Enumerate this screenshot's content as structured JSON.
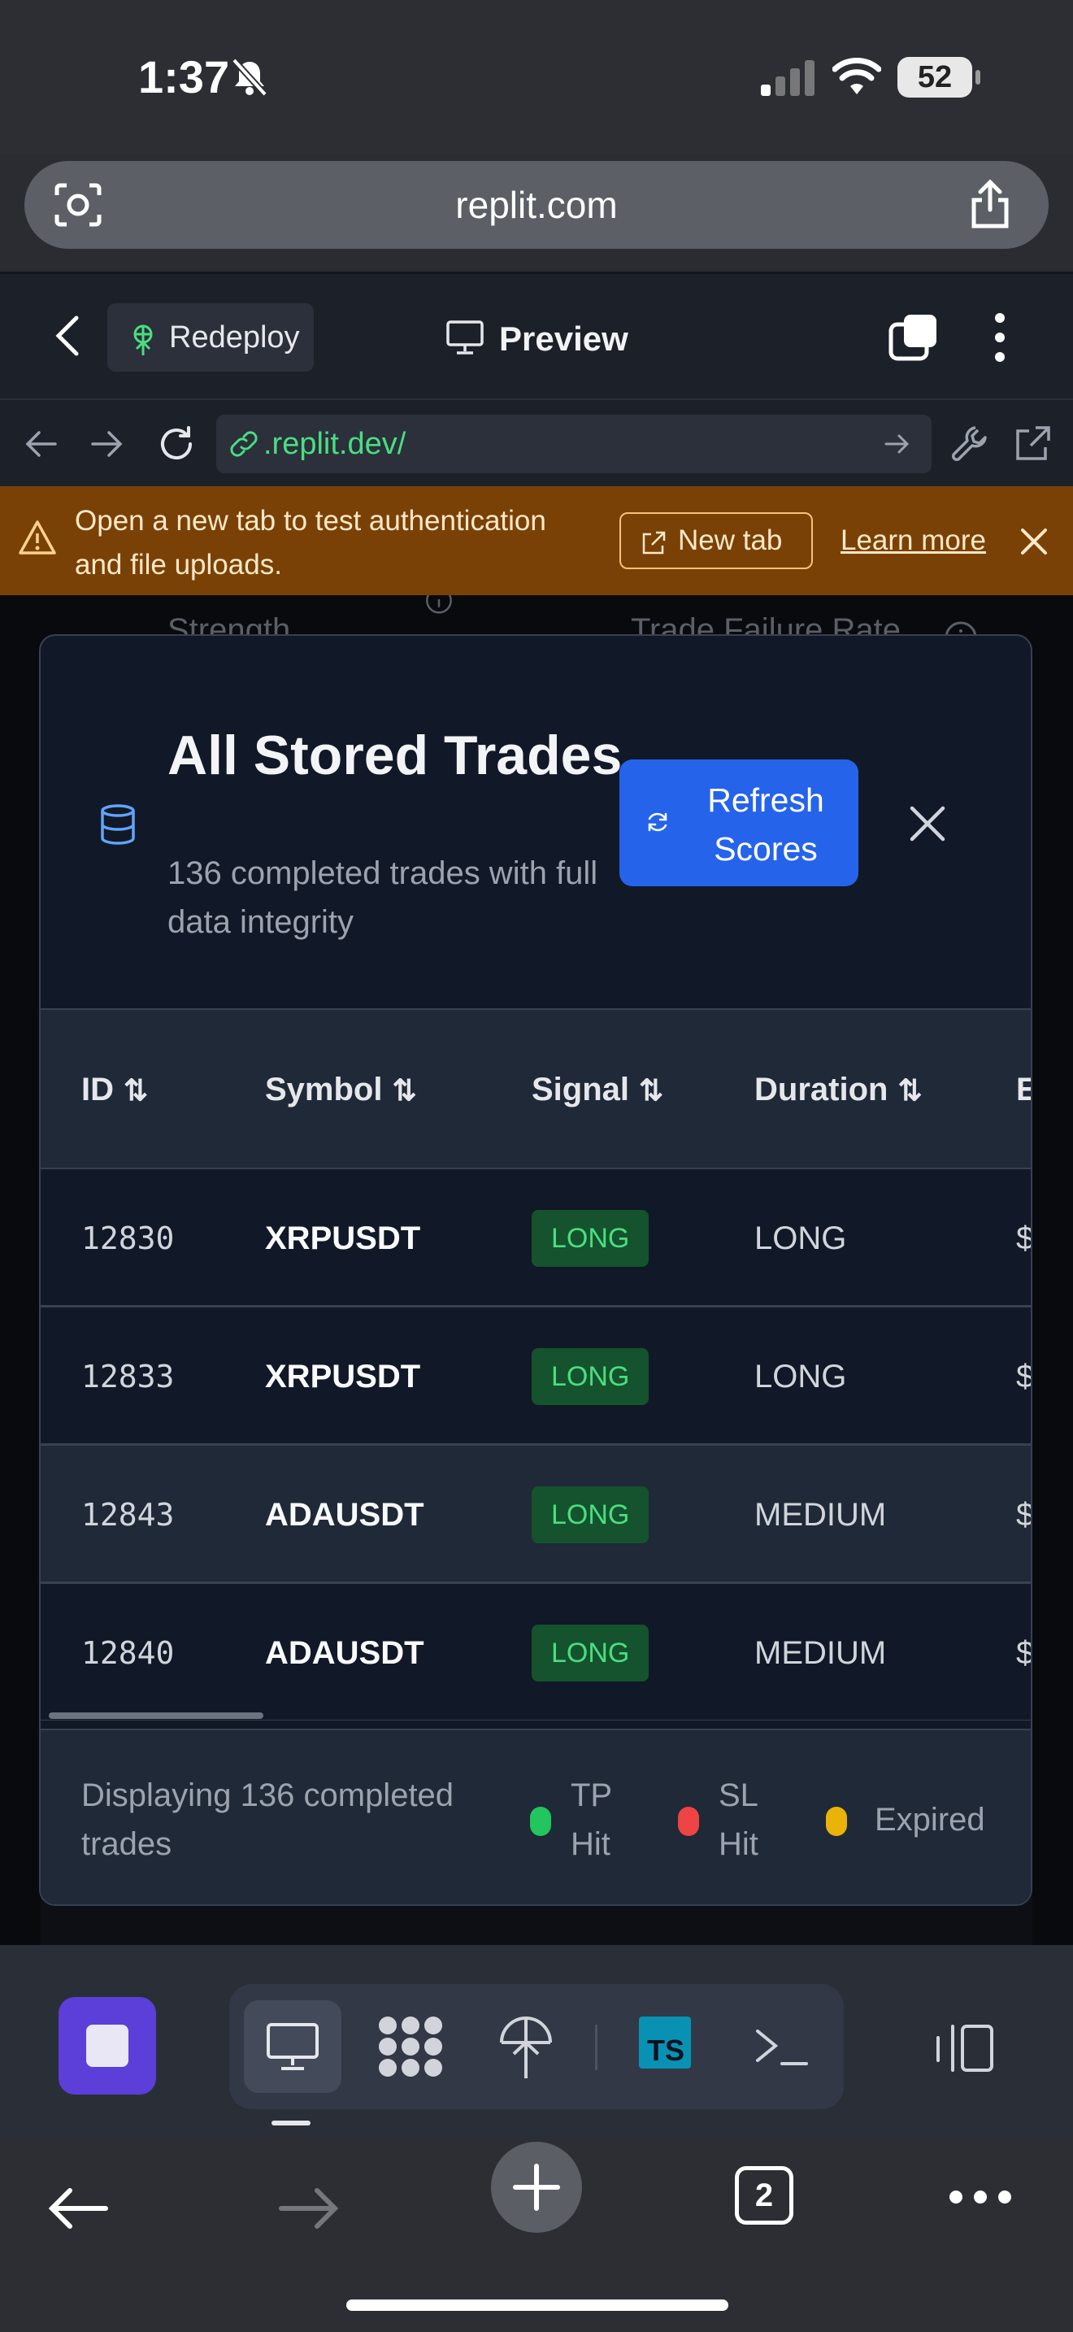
{
  "status_bar": {
    "time": "1:37",
    "battery": "52"
  },
  "browser": {
    "url": "replit.com"
  },
  "replit_header": {
    "redeploy_label": "Redeploy",
    "preview_label": "Preview"
  },
  "webview_nav": {
    "address": ".replit.dev/"
  },
  "banner": {
    "message": "Open a new tab to test authentication and file uploads.",
    "new_tab_label": "New tab",
    "learn_more_label": "Learn more"
  },
  "background": {
    "left_label": "Strength",
    "right_label": "Trade Failure Rate"
  },
  "modal": {
    "title": "All Stored Trades",
    "subtitle": "136 completed trades with full data integrity",
    "refresh_label": "Refresh Scores",
    "table": {
      "columns": [
        "ID",
        "Symbol",
        "Signal",
        "Duration",
        "E"
      ],
      "rows": [
        {
          "id": "12830",
          "symbol": "XRPUSDT",
          "signal": "LONG",
          "duration": "LONG",
          "price": "$"
        },
        {
          "id": "12833",
          "symbol": "XRPUSDT",
          "signal": "LONG",
          "duration": "LONG",
          "price": "$"
        },
        {
          "id": "12843",
          "symbol": "ADAUSDT",
          "signal": "LONG",
          "duration": "MEDIUM",
          "price": "$"
        },
        {
          "id": "12840",
          "symbol": "ADAUSDT",
          "signal": "LONG",
          "duration": "MEDIUM",
          "price": "$"
        }
      ]
    },
    "footer": {
      "summary": "Displaying 136 completed trades",
      "legend": [
        {
          "label": "TP Hit",
          "color": "#22c55e"
        },
        {
          "label": "SL Hit",
          "color": "#ef4444"
        },
        {
          "label": "Expired",
          "color": "#eab308"
        }
      ]
    }
  },
  "bottom_bar": {
    "open_tabs": "2"
  },
  "colors": {
    "accent": "#2563eb",
    "banner": "#7a4107",
    "long_badge": "#14532d",
    "stop_button": "#5b3fd8"
  }
}
